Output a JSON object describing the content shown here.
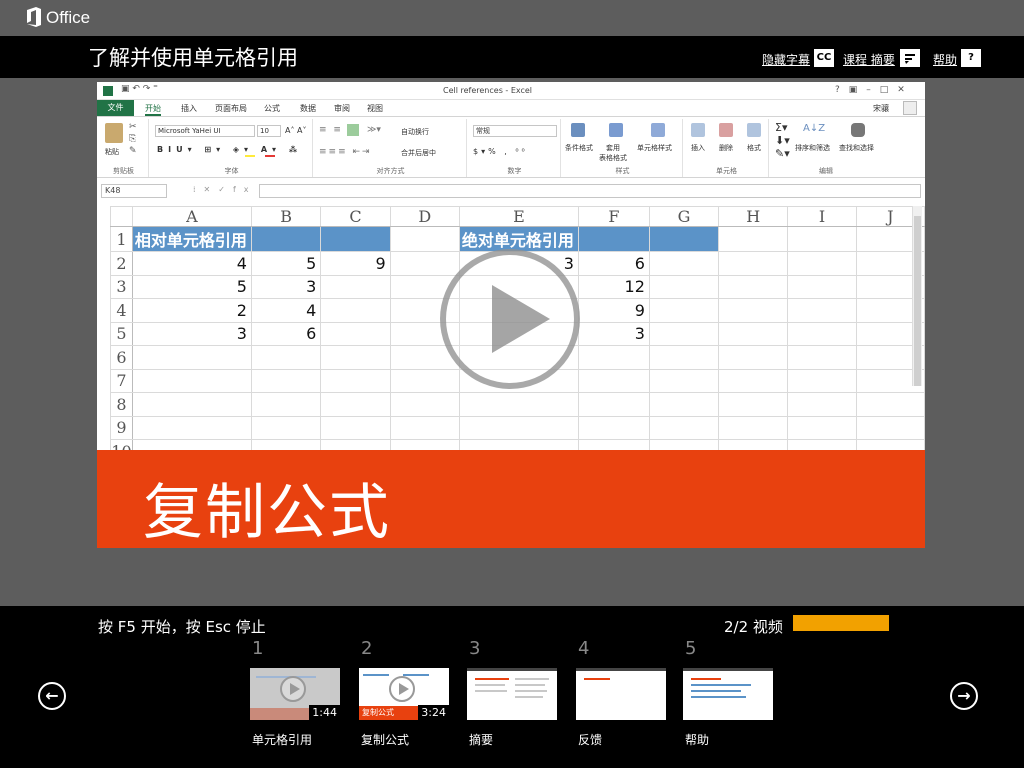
{
  "brand": "Office",
  "header": {
    "title": "了解并使用单元格引用",
    "captions_label": "隐藏字幕",
    "captions_icon": "CC",
    "summary_label": "课程 摘要",
    "help_label": "帮助",
    "help_icon": "?"
  },
  "excel": {
    "window_title": "Cell references - Excel",
    "user": "宋骧",
    "tabs": [
      "文件",
      "开始",
      "插入",
      "页面布局",
      "公式",
      "数据",
      "审阅",
      "视图"
    ],
    "ribbon": {
      "clipboard": "剪贴板",
      "paste": "粘贴",
      "font_name": "Microsoft YaHei UI",
      "font_size": "10",
      "font_group": "字体",
      "wrap": "自动换行",
      "merge": "合并后居中",
      "align_group": "对齐方式",
      "number_format": "常规",
      "number_group": "数字",
      "cond_format": "条件格式",
      "table_format": "套用\n表格格式",
      "cell_styles": "单元格样式",
      "styles_group": "样式",
      "insert": "插入",
      "delete": "删除",
      "format": "格式",
      "cells_group": "单元格",
      "sort_filter": "排序和筛选",
      "find_select": "查找和选择",
      "edit_group": "编辑"
    },
    "name_box": "K48",
    "columns": [
      "A",
      "B",
      "C",
      "D",
      "E",
      "F",
      "G",
      "H",
      "I",
      "J"
    ],
    "rows": [
      {
        "n": "1",
        "cells": [
          "相对单元格引用",
          "",
          "",
          "",
          "绝对单元格引用",
          "",
          "",
          "",
          "",
          ""
        ]
      },
      {
        "n": "2",
        "cells": [
          "4",
          "5",
          "9",
          "",
          "3",
          "6",
          "",
          "",
          "",
          ""
        ]
      },
      {
        "n": "3",
        "cells": [
          "5",
          "3",
          "",
          "",
          "",
          "12",
          "",
          "",
          "",
          ""
        ]
      },
      {
        "n": "4",
        "cells": [
          "2",
          "4",
          "",
          "",
          "",
          "9",
          "",
          "",
          "",
          ""
        ]
      },
      {
        "n": "5",
        "cells": [
          "3",
          "6",
          "",
          "",
          "",
          "3",
          "",
          "",
          "",
          ""
        ]
      },
      {
        "n": "6",
        "cells": [
          "",
          "",
          "",
          "",
          "",
          "",
          "",
          "",
          "",
          ""
        ]
      },
      {
        "n": "7",
        "cells": [
          "",
          "",
          "",
          "",
          "",
          "",
          "",
          "",
          "",
          ""
        ]
      },
      {
        "n": "8",
        "cells": [
          "",
          "",
          "",
          "",
          "",
          "",
          "",
          "",
          "",
          ""
        ]
      },
      {
        "n": "9",
        "cells": [
          "",
          "",
          "",
          "",
          "",
          "",
          "",
          "",
          "",
          ""
        ]
      },
      {
        "n": "10",
        "cells": [
          "",
          "",
          "",
          "",
          "",
          "",
          "",
          "",
          "",
          ""
        ]
      }
    ]
  },
  "banner": "复制公式",
  "footer": {
    "hint": "按 F5 开始，按 Esc 停止",
    "counter": "2/2 视频",
    "progress": 1.0,
    "progress_color": "#f2a100",
    "thumbs": [
      {
        "num": "1",
        "label": "单元格引用",
        "duration": "1:44"
      },
      {
        "num": "2",
        "label": "复制公式",
        "duration": "3:24"
      },
      {
        "num": "3",
        "label": "摘要",
        "duration": ""
      },
      {
        "num": "4",
        "label": "反馈",
        "duration": ""
      },
      {
        "num": "5",
        "label": "帮助",
        "duration": ""
      }
    ]
  },
  "colors": {
    "accent": "#e8410f",
    "excel_green": "#217346",
    "header_blue": "#5b93c8"
  }
}
